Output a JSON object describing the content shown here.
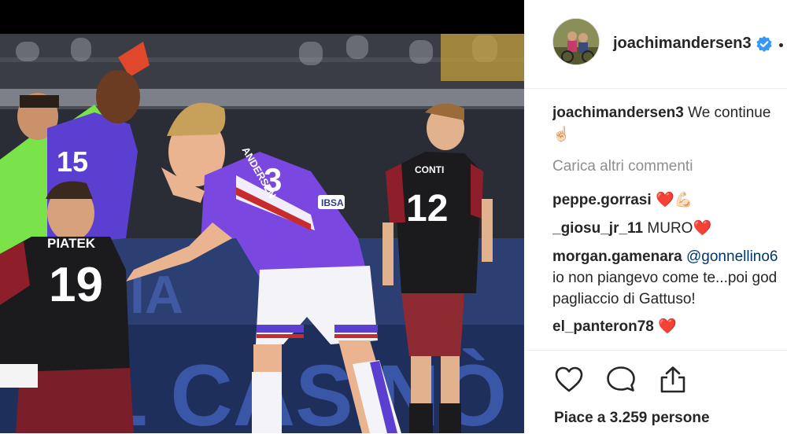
{
  "post": {
    "username": "joachimandersen3",
    "verified_icon": "verified-badge-icon",
    "options_icon": "more-dot-icon",
    "accent_color": "#3897f0"
  },
  "comments": {
    "caption": {
      "user": "joachimandersen3",
      "text": "We continue",
      "emoji": "☝🏻"
    },
    "load_more": "Carica altri commenti",
    "items": [
      {
        "user": "peppe.gorrasi",
        "text": "❤️💪🏻"
      },
      {
        "user": "_giosu_jr_11",
        "text": "MURO❤️"
      },
      {
        "user": "morgan.gamenara",
        "mention": "@gonnellino6",
        "line2": "io non piangevo come te...poi god",
        "line3": "pagliaccio di Gattuso!"
      },
      {
        "user": "el_panteron78",
        "text": "❤️"
      }
    ]
  },
  "actions": {
    "like_icon": "heart-icon",
    "comment_icon": "comment-bubble-icon",
    "share_icon": "share-icon",
    "likes_text": "Piace a 3.259 persone"
  },
  "photo": {
    "jersey_left_name": "PIATEK",
    "jersey_left_number": "19",
    "jersey_center_number": "3",
    "jersey_center_name": "ANDERSEN",
    "jersey_right_name": "CONTI",
    "jersey_right_number": "12",
    "jersey_sponsor": "IBSA",
    "board_text": "IL CASINÒ",
    "board_text_left": "IA"
  }
}
